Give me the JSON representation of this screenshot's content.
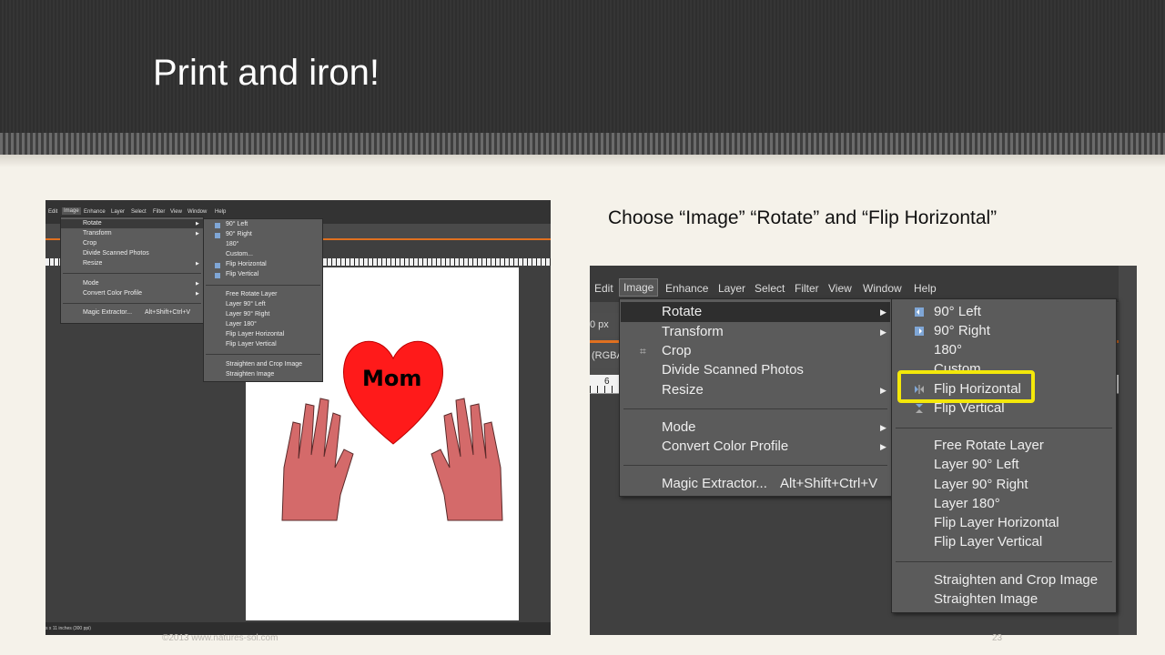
{
  "slide": {
    "title": "Print and iron!",
    "caption": "Choose “Image” “Rotate” and “Flip Horizontal”",
    "footer": "©2013 www.natures-sol.com",
    "page_number": "23"
  },
  "left_screenshot": {
    "menubar": [
      "Edit",
      "Image",
      "Enhance",
      "Layer",
      "Select",
      "Filter",
      "View",
      "Window",
      "Help"
    ],
    "image_menu": {
      "items": [
        "Rotate",
        "Transform",
        "Crop",
        "Divide Scanned Photos",
        "Resize",
        "Mode",
        "Convert Color Profile",
        "Magic Extractor..."
      ],
      "shortcut": "Alt+Shift+Ctrl+V"
    },
    "rotate_submenu": [
      "90° Left",
      "90° Right",
      "180°",
      "Custom...",
      "Flip Horizontal",
      "Flip Vertical",
      "Free Rotate Layer",
      "Layer 90° Left",
      "Layer 90° Right",
      "Layer 180°",
      "Flip Layer Horizontal",
      "Flip Layer Vertical",
      "Straighten and Crop Image",
      "Straighten Image"
    ],
    "canvas_text": "Mom",
    "status_text": "s x 11 inches (300 ppi)",
    "heart_color": "#ff1a1a",
    "hand_color": "#d46a6a"
  },
  "right_screenshot": {
    "menubar": [
      "Edit",
      "Image",
      "Enhance",
      "Layer",
      "Select",
      "Filter",
      "View",
      "Window",
      "Help"
    ],
    "options_text": "0 px",
    "mode_text": "(RGBA",
    "ruler_mark": "6",
    "image_menu": {
      "items": [
        "Rotate",
        "Transform",
        "Crop",
        "Divide Scanned Photos",
        "Resize",
        "Mode",
        "Convert Color Profile",
        "Magic Extractor..."
      ],
      "shortcut": "Alt+Shift+Ctrl+V"
    },
    "rotate_submenu": [
      "90° Left",
      "90° Right",
      "180°",
      "Custom...",
      "Flip Horizontal",
      "Flip Vertical",
      "Free Rotate Layer",
      "Layer 90° Left",
      "Layer 90° Right",
      "Layer 180°",
      "Flip Layer Horizontal",
      "Flip Layer Vertical",
      "Straighten and Crop Image",
      "Straighten Image"
    ],
    "highlight_color": "#f4e80a",
    "active_item": "Flip Horizontal"
  }
}
